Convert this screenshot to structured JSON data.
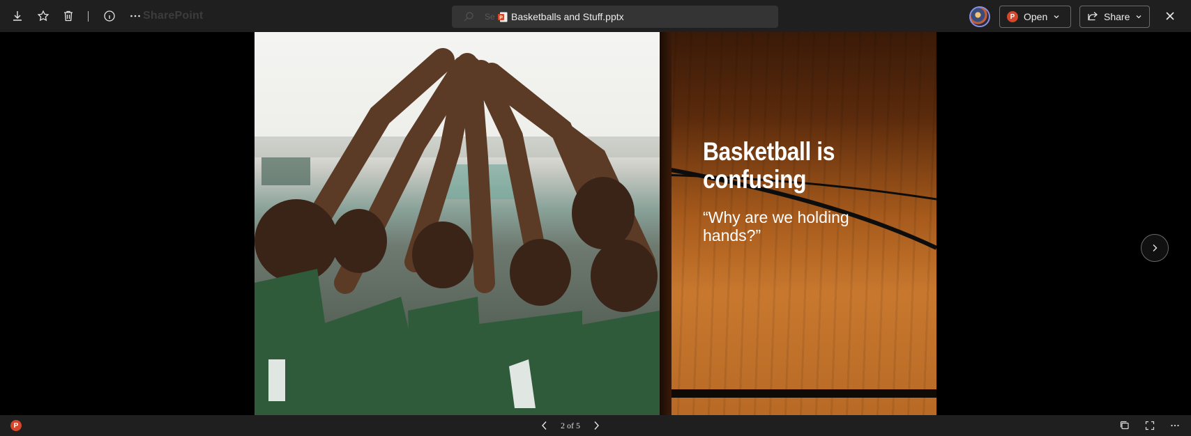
{
  "header": {
    "ghost_label": "SharePoint",
    "search_ghost": "Se",
    "filename": "Basketballs and Stuff.pptx",
    "open_label": "Open",
    "share_label": "Share",
    "icons": [
      "download-icon",
      "star-icon",
      "delete-icon",
      "info-icon",
      "more-icon",
      "search-icon",
      "close-icon"
    ]
  },
  "slide": {
    "title": "Basketball is confusing",
    "quote": "“Why are we holding hands?”"
  },
  "footer": {
    "page_indicator": "2 of 5",
    "app_badge": "P"
  },
  "colors": {
    "powerpoint_accent": "#d4472a",
    "bar_background": "#1f1f1f"
  }
}
